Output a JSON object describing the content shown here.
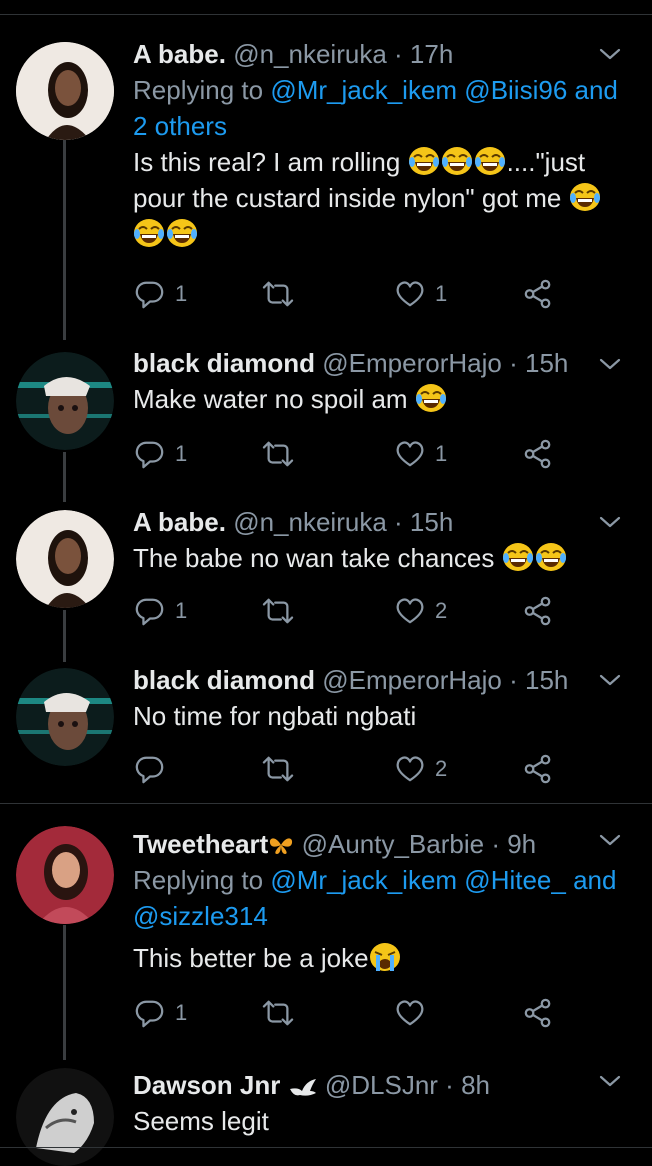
{
  "colors": {
    "background": "#000000",
    "link": "#1d9bf0",
    "muted": "#8b98a5",
    "text": "#e7e9ea"
  },
  "tweets": [
    {
      "name": "A babe.",
      "handle": "@n_nkeiruka",
      "time": "17h",
      "replying_prefix": "Replying to",
      "replying_mentions": "@Mr_jack_ikem @Biisi96 and",
      "replying_more": "2 others",
      "line1": "Is this real? I am rolling",
      "line1_tail": "....\"just",
      "line2": "pour the custard inside nylon\" got me",
      "replies": "1",
      "likes": "1"
    },
    {
      "name": "black diamond",
      "handle": "@EmperorHajo",
      "time": "15h",
      "text": "Make water no spoil am",
      "replies": "1",
      "likes": "1"
    },
    {
      "name": "A babe.",
      "handle": "@n_nkeiruka",
      "time": "15h",
      "text": "The babe no wan take chances",
      "replies": "1",
      "likes": "2"
    },
    {
      "name": "black diamond",
      "handle": "@EmperorHajo",
      "time": "15h",
      "text": "No time for ngbati ngbati",
      "replies": "",
      "likes": "2"
    },
    {
      "name": "Tweetheart",
      "handle": "@Aunty_Barbie",
      "time": "9h",
      "replying_prefix": "Replying to",
      "replying_mentions": "@Mr_jack_ikem @Hitee_ and",
      "replying_more": "@sizzle314",
      "text": "This better be a joke",
      "replies": "1",
      "likes": ""
    },
    {
      "name": "Dawson Jnr",
      "handle": "@DLSJnr",
      "time": "8h",
      "text": "Seems legit"
    }
  ],
  "separator": "·"
}
